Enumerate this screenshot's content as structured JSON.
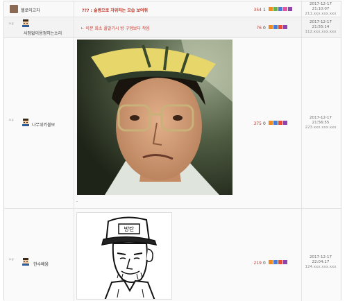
{
  "rows": [
    {
      "nickname": "헬로의고자",
      "title": "??? : 술병으로 자위하는 모습 보여줘",
      "recommend": "354",
      "comments": "1",
      "date": "2017-12-17",
      "time": "21:10:07",
      "ip": "211.xxx.xxx.xxx"
    },
    {
      "badge": "14살",
      "nickname": "사정없이용정하는소리",
      "title": "ㄴ 이분 회소 풀발기시 방 구멍보다 작음",
      "recommend": "76",
      "comments": "0",
      "date": "2017-12-17",
      "time": "21:55:14",
      "ip": "112.xxx.xxx.xxx"
    },
    {
      "badge": "14살",
      "nickname": "나무위키블보",
      "recommend": "375",
      "comments": "0",
      "date": "2017-12-17",
      "time": "21:56:55",
      "ip": "223.xxx.xxx.xxx",
      "extra": "."
    },
    {
      "badge": "14살",
      "nickname": "한수배움",
      "cap_text": "방탄",
      "recommend": "219",
      "comments": "0",
      "date": "2017-12-17",
      "time": "22:04:17",
      "ip": "124.xxx.xxx.xxx"
    }
  ],
  "colors": {
    "title_red": "#c0392b",
    "reply_red": "#d0352b",
    "btn_orange": "#f08a24",
    "btn_green": "#6ab04c",
    "btn_blue": "#4a7bd0",
    "btn_purple": "#8e44ad",
    "btn_red": "#e74c3c",
    "btn_pink": "#e056a0"
  }
}
